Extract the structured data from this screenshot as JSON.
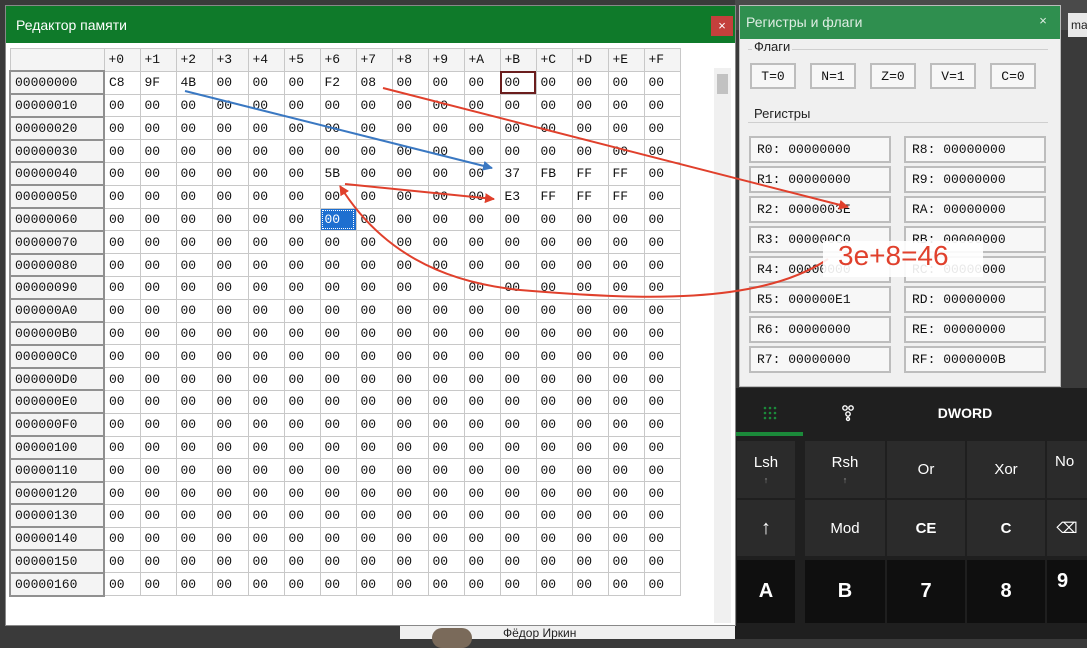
{
  "background": {
    "tab_fragment": "mar",
    "bottom_text": "Фёдор Иркин"
  },
  "calculator": {
    "mode_label": "DWORD",
    "tabs": [
      {
        "icon": "keypad-icon"
      },
      {
        "icon": "bit-toggle-icon"
      },
      {
        "label": "DWORD"
      }
    ],
    "buttons": [
      {
        "label": "Lsh",
        "sub": "↑"
      },
      {
        "label": "Rsh",
        "sub": "↑"
      },
      {
        "label": "Or"
      },
      {
        "label": "Xor"
      },
      {
        "label": "No"
      },
      {
        "label": "↑"
      },
      {
        "label": "Mod"
      },
      {
        "label": "CE"
      },
      {
        "label": "C"
      },
      {
        "label": "⌫"
      },
      {
        "label": "A"
      },
      {
        "label": "B"
      },
      {
        "label": "7"
      },
      {
        "label": "8"
      },
      {
        "label": "9"
      }
    ]
  },
  "registers_window": {
    "title": "Регистры и флаги",
    "close_label": "×",
    "flags_label": "Флаги",
    "flags": [
      "T=0",
      "N=1",
      "Z=0",
      "V=1",
      "C=0"
    ],
    "registers_label": "Регистры",
    "registers_left": [
      "R0: 00000000",
      "R1: 00000000",
      "R2: 0000003E",
      "R3: 000000C0",
      "R4: 00000000",
      "R5: 000000E1",
      "R6: 00000000",
      "R7: 00000000"
    ],
    "registers_right": [
      "R8: 00000000",
      "R9: 00000000",
      "RA: 00000000",
      "RB: 00000000",
      "RC: 00000000",
      "RD: 00000000",
      "RE: 00000000",
      "RF: 0000000B"
    ]
  },
  "memory_editor": {
    "title": "Редактор памяти",
    "close_label": "×",
    "columns": [
      "+0",
      "+1",
      "+2",
      "+3",
      "+4",
      "+5",
      "+6",
      "+7",
      "+8",
      "+9",
      "+A",
      "+B",
      "+C",
      "+D",
      "+E",
      "+F"
    ],
    "selected_cell": {
      "row": 6,
      "col": 6
    },
    "current_cell": {
      "row": 0,
      "col": 11
    },
    "rows": [
      {
        "addr": "00000000",
        "cells": [
          "C8",
          "9F",
          "4B",
          "00",
          "00",
          "00",
          "F2",
          "08",
          "00",
          "00",
          "00",
          "00",
          "00",
          "00",
          "00",
          "00"
        ]
      },
      {
        "addr": "00000010",
        "cells": [
          "00",
          "00",
          "00",
          "00",
          "00",
          "00",
          "00",
          "00",
          "00",
          "00",
          "00",
          "00",
          "00",
          "00",
          "00",
          "00"
        ]
      },
      {
        "addr": "00000020",
        "cells": [
          "00",
          "00",
          "00",
          "00",
          "00",
          "00",
          "00",
          "00",
          "00",
          "00",
          "00",
          "00",
          "00",
          "00",
          "00",
          "00"
        ]
      },
      {
        "addr": "00000030",
        "cells": [
          "00",
          "00",
          "00",
          "00",
          "00",
          "00",
          "00",
          "00",
          "00",
          "00",
          "00",
          "00",
          "00",
          "00",
          "00",
          "00"
        ]
      },
      {
        "addr": "00000040",
        "cells": [
          "00",
          "00",
          "00",
          "00",
          "00",
          "00",
          "5B",
          "00",
          "00",
          "00",
          "00",
          "37",
          "FB",
          "FF",
          "FF",
          "00"
        ]
      },
      {
        "addr": "00000050",
        "cells": [
          "00",
          "00",
          "00",
          "00",
          "00",
          "00",
          "00",
          "00",
          "00",
          "00",
          "00",
          "E3",
          "FF",
          "FF",
          "FF",
          "00"
        ]
      },
      {
        "addr": "00000060",
        "cells": [
          "00",
          "00",
          "00",
          "00",
          "00",
          "00",
          "00",
          "00",
          "00",
          "00",
          "00",
          "00",
          "00",
          "00",
          "00",
          "00"
        ]
      },
      {
        "addr": "00000070",
        "cells": [
          "00",
          "00",
          "00",
          "00",
          "00",
          "00",
          "00",
          "00",
          "00",
          "00",
          "00",
          "00",
          "00",
          "00",
          "00",
          "00"
        ]
      },
      {
        "addr": "00000080",
        "cells": [
          "00",
          "00",
          "00",
          "00",
          "00",
          "00",
          "00",
          "00",
          "00",
          "00",
          "00",
          "00",
          "00",
          "00",
          "00",
          "00"
        ]
      },
      {
        "addr": "00000090",
        "cells": [
          "00",
          "00",
          "00",
          "00",
          "00",
          "00",
          "00",
          "00",
          "00",
          "00",
          "00",
          "00",
          "00",
          "00",
          "00",
          "00"
        ]
      },
      {
        "addr": "000000A0",
        "cells": [
          "00",
          "00",
          "00",
          "00",
          "00",
          "00",
          "00",
          "00",
          "00",
          "00",
          "00",
          "00",
          "00",
          "00",
          "00",
          "00"
        ]
      },
      {
        "addr": "000000B0",
        "cells": [
          "00",
          "00",
          "00",
          "00",
          "00",
          "00",
          "00",
          "00",
          "00",
          "00",
          "00",
          "00",
          "00",
          "00",
          "00",
          "00"
        ]
      },
      {
        "addr": "000000C0",
        "cells": [
          "00",
          "00",
          "00",
          "00",
          "00",
          "00",
          "00",
          "00",
          "00",
          "00",
          "00",
          "00",
          "00",
          "00",
          "00",
          "00"
        ]
      },
      {
        "addr": "000000D0",
        "cells": [
          "00",
          "00",
          "00",
          "00",
          "00",
          "00",
          "00",
          "00",
          "00",
          "00",
          "00",
          "00",
          "00",
          "00",
          "00",
          "00"
        ]
      },
      {
        "addr": "000000E0",
        "cells": [
          "00",
          "00",
          "00",
          "00",
          "00",
          "00",
          "00",
          "00",
          "00",
          "00",
          "00",
          "00",
          "00",
          "00",
          "00",
          "00"
        ]
      },
      {
        "addr": "000000F0",
        "cells": [
          "00",
          "00",
          "00",
          "00",
          "00",
          "00",
          "00",
          "00",
          "00",
          "00",
          "00",
          "00",
          "00",
          "00",
          "00",
          "00"
        ]
      },
      {
        "addr": "00000100",
        "cells": [
          "00",
          "00",
          "00",
          "00",
          "00",
          "00",
          "00",
          "00",
          "00",
          "00",
          "00",
          "00",
          "00",
          "00",
          "00",
          "00"
        ]
      },
      {
        "addr": "00000110",
        "cells": [
          "00",
          "00",
          "00",
          "00",
          "00",
          "00",
          "00",
          "00",
          "00",
          "00",
          "00",
          "00",
          "00",
          "00",
          "00",
          "00"
        ]
      },
      {
        "addr": "00000120",
        "cells": [
          "00",
          "00",
          "00",
          "00",
          "00",
          "00",
          "00",
          "00",
          "00",
          "00",
          "00",
          "00",
          "00",
          "00",
          "00",
          "00"
        ]
      },
      {
        "addr": "00000130",
        "cells": [
          "00",
          "00",
          "00",
          "00",
          "00",
          "00",
          "00",
          "00",
          "00",
          "00",
          "00",
          "00",
          "00",
          "00",
          "00",
          "00"
        ]
      },
      {
        "addr": "00000140",
        "cells": [
          "00",
          "00",
          "00",
          "00",
          "00",
          "00",
          "00",
          "00",
          "00",
          "00",
          "00",
          "00",
          "00",
          "00",
          "00",
          "00"
        ]
      },
      {
        "addr": "00000150",
        "cells": [
          "00",
          "00",
          "00",
          "00",
          "00",
          "00",
          "00",
          "00",
          "00",
          "00",
          "00",
          "00",
          "00",
          "00",
          "00",
          "00"
        ]
      },
      {
        "addr": "00000160",
        "cells": [
          "00",
          "00",
          "00",
          "00",
          "00",
          "00",
          "00",
          "00",
          "00",
          "00",
          "00",
          "00",
          "00",
          "00",
          "00",
          "00"
        ]
      }
    ]
  },
  "annotations": {
    "formula": "3e+8=46",
    "colors": {
      "red": "#e0402c",
      "blue": "#3a78c2"
    }
  }
}
